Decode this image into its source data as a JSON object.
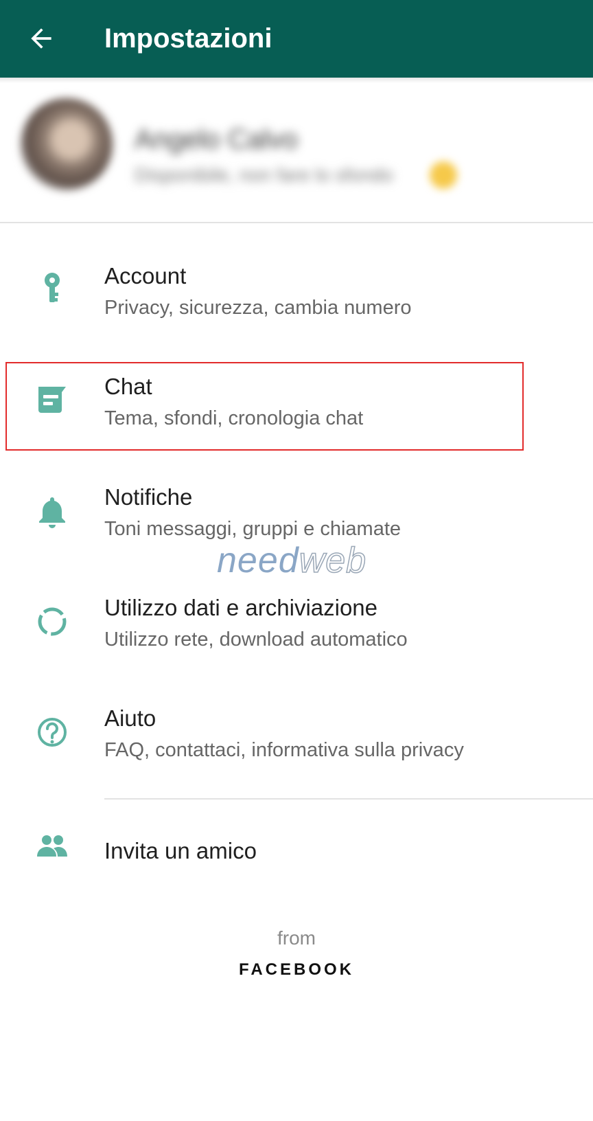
{
  "app_bar": {
    "title": "Impostazioni",
    "back_icon": "arrow-back-icon",
    "background_color": "#075e54"
  },
  "profile": {
    "name": "Angelo Calvo",
    "status": "Disponibile, non fare lo sfondo",
    "note": "blurred"
  },
  "menu": {
    "items": [
      {
        "label": "Account",
        "subtitle": "Privacy, sicurezza, cambia numero",
        "icon": "key-icon"
      },
      {
        "label": "Chat",
        "subtitle": "Tema, sfondi, cronologia chat",
        "icon": "chat-icon",
        "highlighted": true
      },
      {
        "label": "Notifiche",
        "subtitle": "Toni messaggi, gruppi e chiamate",
        "icon": "bell-icon"
      },
      {
        "label": "Utilizzo dati e archiviazione",
        "subtitle": "Utilizzo rete, download automatico",
        "icon": "data-usage-icon"
      },
      {
        "label": "Aiuto",
        "subtitle": "FAQ, contattaci, informativa sulla privacy",
        "icon": "help-icon"
      },
      {
        "label": "Invita un amico",
        "icon": "people-icon"
      }
    ]
  },
  "watermark": {
    "part1": "need",
    "part2": "web"
  },
  "footer": {
    "from": "from",
    "brand": "FACEBOOK"
  },
  "colors": {
    "icon_tint": "#5fb3a2",
    "highlight_border": "#e22b2b"
  }
}
